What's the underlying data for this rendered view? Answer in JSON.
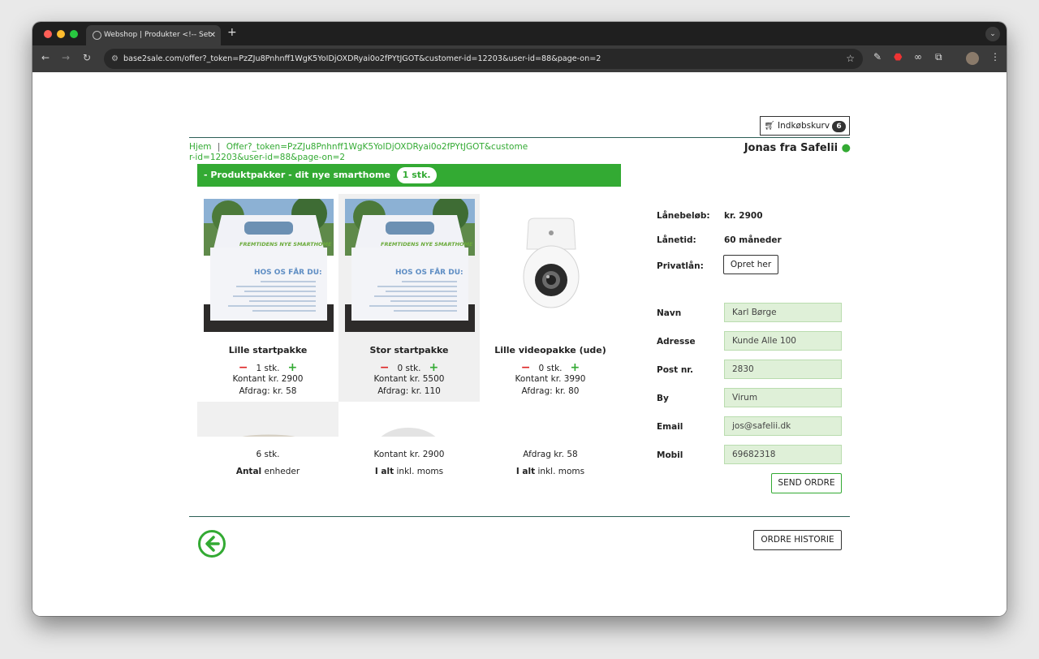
{
  "browser": {
    "tab_title": "Webshop | Produkter <!-- Set",
    "url": "base2sale.com/offer?_token=PzZJu8Pnhnff1WgK5YoIDjOXDRyai0o2fPYtJGOT&customer-id=12203&user-id=88&page-on=2"
  },
  "header": {
    "cart_label": "Indkøbskurv",
    "cart_count": "6",
    "breadcrumb_home": "Hjem",
    "breadcrumb_sep": "|",
    "breadcrumb_current": "Offer?_token=PzZJu8Pnhnff1WgK5YoIDjOXDRyai0o2fPYtJGOT&customer-id=12203&user-id=88&page-on=2",
    "user_name": "Jonas fra Safelii"
  },
  "category": {
    "collapse_symbol": "-",
    "title": "Produktpakker - dit nye smarthome",
    "count": "1 stk."
  },
  "products": [
    {
      "name": "Lille startpakke",
      "qty": "1 stk.",
      "kontant": "Kontant kr. 2900",
      "afdrag": "Afdrag: kr. 58",
      "box_brand": "FREMTIDENS NYE SMARTHOME",
      "box_heading": "HOS OS FÅR DU:"
    },
    {
      "name": "Stor startpakke",
      "qty": "0 stk.",
      "kontant": "Kontant kr. 5500",
      "afdrag": "Afdrag: kr. 110",
      "box_brand": "FREMTIDENS NYE SMARTHOME",
      "box_heading": "HOS OS FÅR DU:"
    },
    {
      "name": "Lille videopakke (ude)",
      "qty": "0 stk.",
      "kontant": "Kontant kr. 3990",
      "afdrag": "Afdrag: kr. 80"
    }
  ],
  "summary": {
    "units_value": "6 stk.",
    "units_label_bold": "Antal",
    "units_label": "enheder",
    "kontant_value": "Kontant kr. 2900",
    "kontant_label_bold": "I alt",
    "kontant_label": "inkl. moms",
    "afdrag_value": "Afdrag kr. 58",
    "afdrag_label_bold": "I alt",
    "afdrag_label": "inkl. moms"
  },
  "loan": {
    "amount_label": "Lånebeløb:",
    "amount_value": "kr. 2900",
    "term_label": "Lånetid:",
    "term_value": "60 måneder",
    "private_label": "Privatlån:",
    "private_button": "Opret her"
  },
  "form": {
    "name_label": "Navn",
    "name_value": "Karl Børge",
    "address_label": "Adresse",
    "address_value": "Kunde Alle 100",
    "postal_label": "Post nr.",
    "postal_value": "2830",
    "city_label": "By",
    "city_value": "Virum",
    "email_label": "Email",
    "email_value": "jos@safelii.dk",
    "mobile_label": "Mobil",
    "mobile_value": "69682318",
    "send_button": "SEND ORDRE"
  },
  "footer": {
    "history_button": "ORDRE HISTORIE"
  },
  "colors": {
    "accent": "#33aa33",
    "minus": "#dd2222",
    "rule": "#2c5f56",
    "input_bg": "#dff0d8"
  }
}
